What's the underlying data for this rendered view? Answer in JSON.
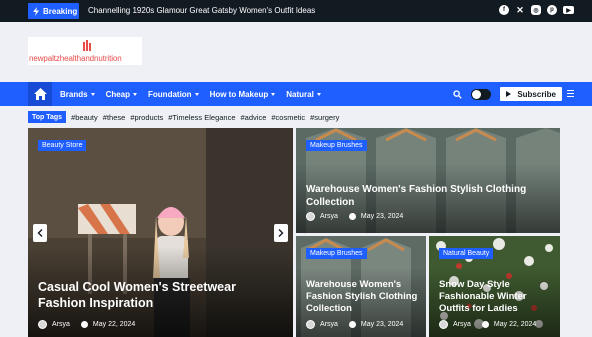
{
  "topbar": {
    "breaking_label": "Breaking",
    "ticker_text": "Channelling 1920s Glamour Great Gatsby Women's Outfit Ideas",
    "socials": [
      "facebook-icon",
      "x-icon",
      "instagram-icon",
      "pinterest-icon",
      "youtube-icon"
    ]
  },
  "logo": {
    "text": "newpaltzhealthandnutrition"
  },
  "nav": {
    "items": [
      {
        "label": "Brands"
      },
      {
        "label": "Cheap"
      },
      {
        "label": "Foundation"
      },
      {
        "label": "How to Makeup"
      },
      {
        "label": "Natural"
      }
    ],
    "subscribe_label": "Subscribe"
  },
  "tags": {
    "label": "Top Tags",
    "items": [
      "#beauty",
      "#these",
      "#products",
      "#Timeless Elegance",
      "#advice",
      "#cosmetic",
      "#surgery"
    ]
  },
  "posts": [
    {
      "category": "Beauty Store",
      "title": "Casual Cool Women's Streetwear Fashion Inspiration",
      "author": "Arsya",
      "date": "May 22, 2024"
    },
    {
      "category": "Makeup Brushes",
      "title": "Warehouse Women's Fashion Stylish Clothing Collection",
      "author": "Arsya",
      "date": "May 23, 2024"
    },
    {
      "category": "Makeup Brushes",
      "title": "Warehouse Women's Fashion Stylish Clothing Collection",
      "author": "Arsya",
      "date": "May 23, 2024"
    },
    {
      "category": "Natural Beauty",
      "title": "Snow Day Style Fashionable Winter Outfits for Ladies",
      "author": "Arsya",
      "date": "May 22, 2024"
    }
  ],
  "colors": {
    "accent": "#1f5eff",
    "topbar": "#121a22",
    "logo_text": "#e94b4b"
  }
}
